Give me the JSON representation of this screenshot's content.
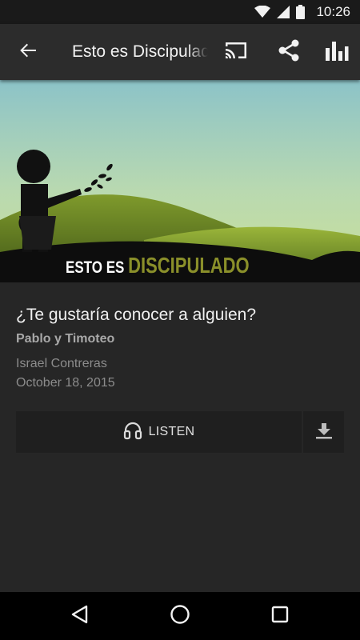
{
  "status_bar": {
    "time": "10:26",
    "icons": [
      "wifi-icon",
      "signal-icon",
      "battery-icon"
    ]
  },
  "toolbar": {
    "title": "Esto es Discipulado",
    "icons": [
      "back-arrow-icon",
      "cast-icon",
      "share-icon",
      "bar-chart-icon"
    ]
  },
  "hero": {
    "text_part1": "ESTO ES ",
    "text_part2": "DISCIPULADO"
  },
  "episode": {
    "title": "¿Te gustaría conocer a alguien?",
    "series": "Pablo y Timoteo",
    "author": "Israel Contreras",
    "date": "October 18, 2015"
  },
  "actions": {
    "listen_label": "LISTEN",
    "listen_icon": "headphones-icon",
    "download_icon": "download-icon"
  },
  "nav_bar": {
    "icons": [
      "nav-back-icon",
      "nav-home-icon",
      "nav-recents-icon"
    ]
  },
  "colors": {
    "background": "#262626",
    "toolbar": "#2c2c2c",
    "button": "#1f1f1f",
    "hero_accent": "#8a8f2a"
  }
}
